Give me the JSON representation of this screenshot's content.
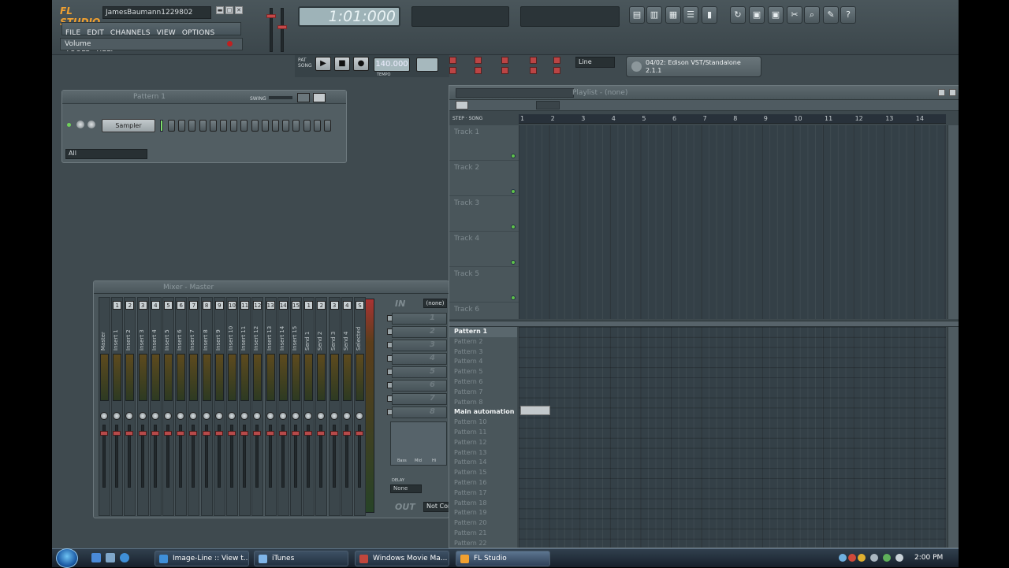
{
  "app": {
    "logo": "FL STUDIO",
    "project_name": "JamesBaumann1229802",
    "time_display": "1:01:000",
    "hint_text": "Volume"
  },
  "menu": [
    "FILE",
    "EDIT",
    "CHANNELS",
    "VIEW",
    "OPTIONS",
    "TOOLS",
    "HELP"
  ],
  "transport": {
    "tempo": "140.000",
    "tempo_label": "TEMPO",
    "pat_label": "PAT",
    "song_label": "SONG"
  },
  "snap": {
    "value": "Line"
  },
  "hint_panel": {
    "line1": "04/02: Edison VST/Standalone",
    "line2": "2.1.1"
  },
  "channel_rack": {
    "title": "Pattern 1",
    "swing_label": "SWING",
    "channel_name": "Sampler",
    "filter": "All",
    "steps": 16
  },
  "mixer": {
    "title": "Mixer - Master",
    "strips": [
      {
        "num": "",
        "label": "Master"
      },
      {
        "num": "1",
        "label": "Insert 1"
      },
      {
        "num": "2",
        "label": "Insert 2"
      },
      {
        "num": "3",
        "label": "Insert 3"
      },
      {
        "num": "4",
        "label": "Insert 4"
      },
      {
        "num": "5",
        "label": "Insert 5"
      },
      {
        "num": "6",
        "label": "Insert 6"
      },
      {
        "num": "7",
        "label": "Insert 7"
      },
      {
        "num": "8",
        "label": "Insert 8"
      },
      {
        "num": "9",
        "label": "Insert 9"
      },
      {
        "num": "10",
        "label": "Insert 10"
      },
      {
        "num": "11",
        "label": "Insert 11"
      },
      {
        "num": "12",
        "label": "Insert 12"
      },
      {
        "num": "13",
        "label": "Insert 13"
      },
      {
        "num": "14",
        "label": "Insert 14"
      },
      {
        "num": "15",
        "label": "Insert 15"
      },
      {
        "num": "1",
        "label": "Send 1"
      },
      {
        "num": "2",
        "label": "Send 2"
      },
      {
        "num": "3",
        "label": "Send 3"
      },
      {
        "num": "4",
        "label": "Send 4"
      },
      {
        "num": "S",
        "label": "Selected"
      }
    ],
    "in_label": "IN",
    "in_value": "(none)",
    "fx_slots": [
      "1",
      "2",
      "3",
      "4",
      "5",
      "6",
      "7",
      "8"
    ],
    "eq_labels": [
      "Bass",
      "Mid",
      "Hi"
    ],
    "delay_label": "DELAY",
    "delay_value": "None",
    "out_label": "OUT",
    "out_value": "Not Connected"
  },
  "playlist": {
    "title": "Playlist - (none)",
    "step_label": "STEP",
    "song_label": "SONG",
    "ruler": [
      "1",
      "2",
      "3",
      "4",
      "5",
      "6",
      "7",
      "8",
      "9",
      "10",
      "11",
      "12",
      "13",
      "14"
    ],
    "tracks": [
      "Track 1",
      "Track 2",
      "Track 3",
      "Track 4",
      "Track 5",
      "Track 6"
    ],
    "patterns": [
      "Pattern 1",
      "Pattern 2",
      "Pattern 3",
      "Pattern 4",
      "Pattern 5",
      "Pattern 6",
      "Pattern 7",
      "Pattern 8",
      "Main automation",
      "Pattern 10",
      "Pattern 11",
      "Pattern 12",
      "Pattern 13",
      "Pattern 14",
      "Pattern 15",
      "Pattern 16",
      "Pattern 17",
      "Pattern 18",
      "Pattern 19",
      "Pattern 20",
      "Pattern 21",
      "Pattern 22"
    ],
    "highlighted_pattern": "Main automation"
  },
  "taskbar": {
    "tasks": [
      {
        "label": "Image-Line :: View t...",
        "icon_color": "#3f8fd8"
      },
      {
        "label": "iTunes",
        "icon_color": "#7fb5e8"
      },
      {
        "label": "Windows Movie Ma...",
        "icon_color": "#c0463c"
      },
      {
        "label": "FL Studio",
        "icon_color": "#f0a030"
      }
    ],
    "clock": "2:00 PM"
  }
}
